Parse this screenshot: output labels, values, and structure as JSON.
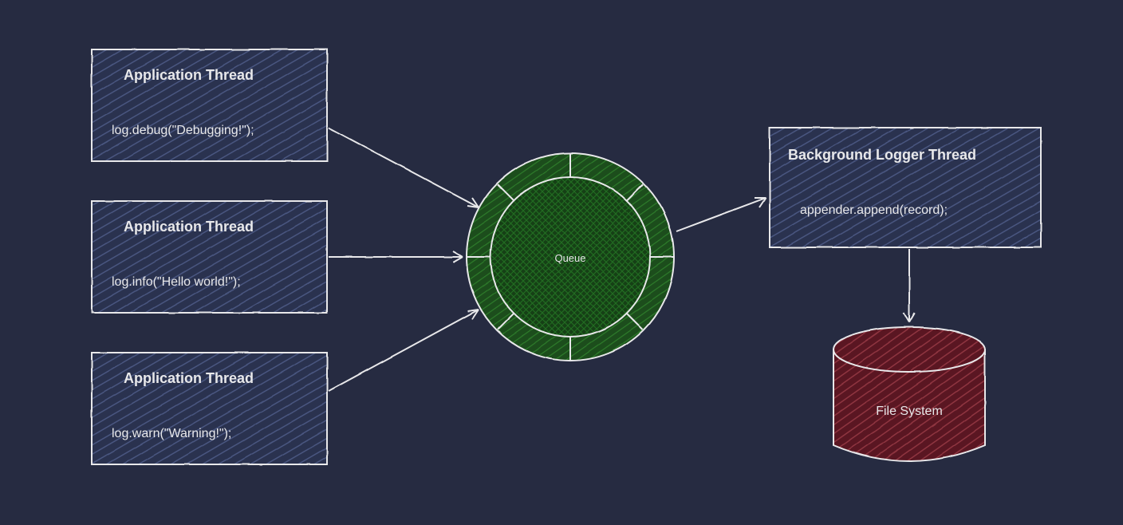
{
  "diagram": {
    "threads": [
      {
        "title": "Application Thread",
        "code": "log.debug(\"Debugging!\");"
      },
      {
        "title": "Application Thread",
        "code": "log.info(\"Hello world!\");"
      },
      {
        "title": "Application Thread",
        "code": "log.warn(\"Warning!\");"
      }
    ],
    "queue": {
      "label": "Queue"
    },
    "logger": {
      "title": "Background Logger Thread",
      "code": "appender.append(record);"
    },
    "store": {
      "label": "File   System"
    },
    "colors": {
      "bg": "#262b41",
      "stroke": "#e8e8ea",
      "threadFill": "#2b3350",
      "hatch": "#6e7aa8",
      "queueFill": "#195a1a",
      "queueHatch": "#2e7a2c",
      "storeFill": "#6e1f2a",
      "storeHatch": "#9a3842"
    }
  }
}
